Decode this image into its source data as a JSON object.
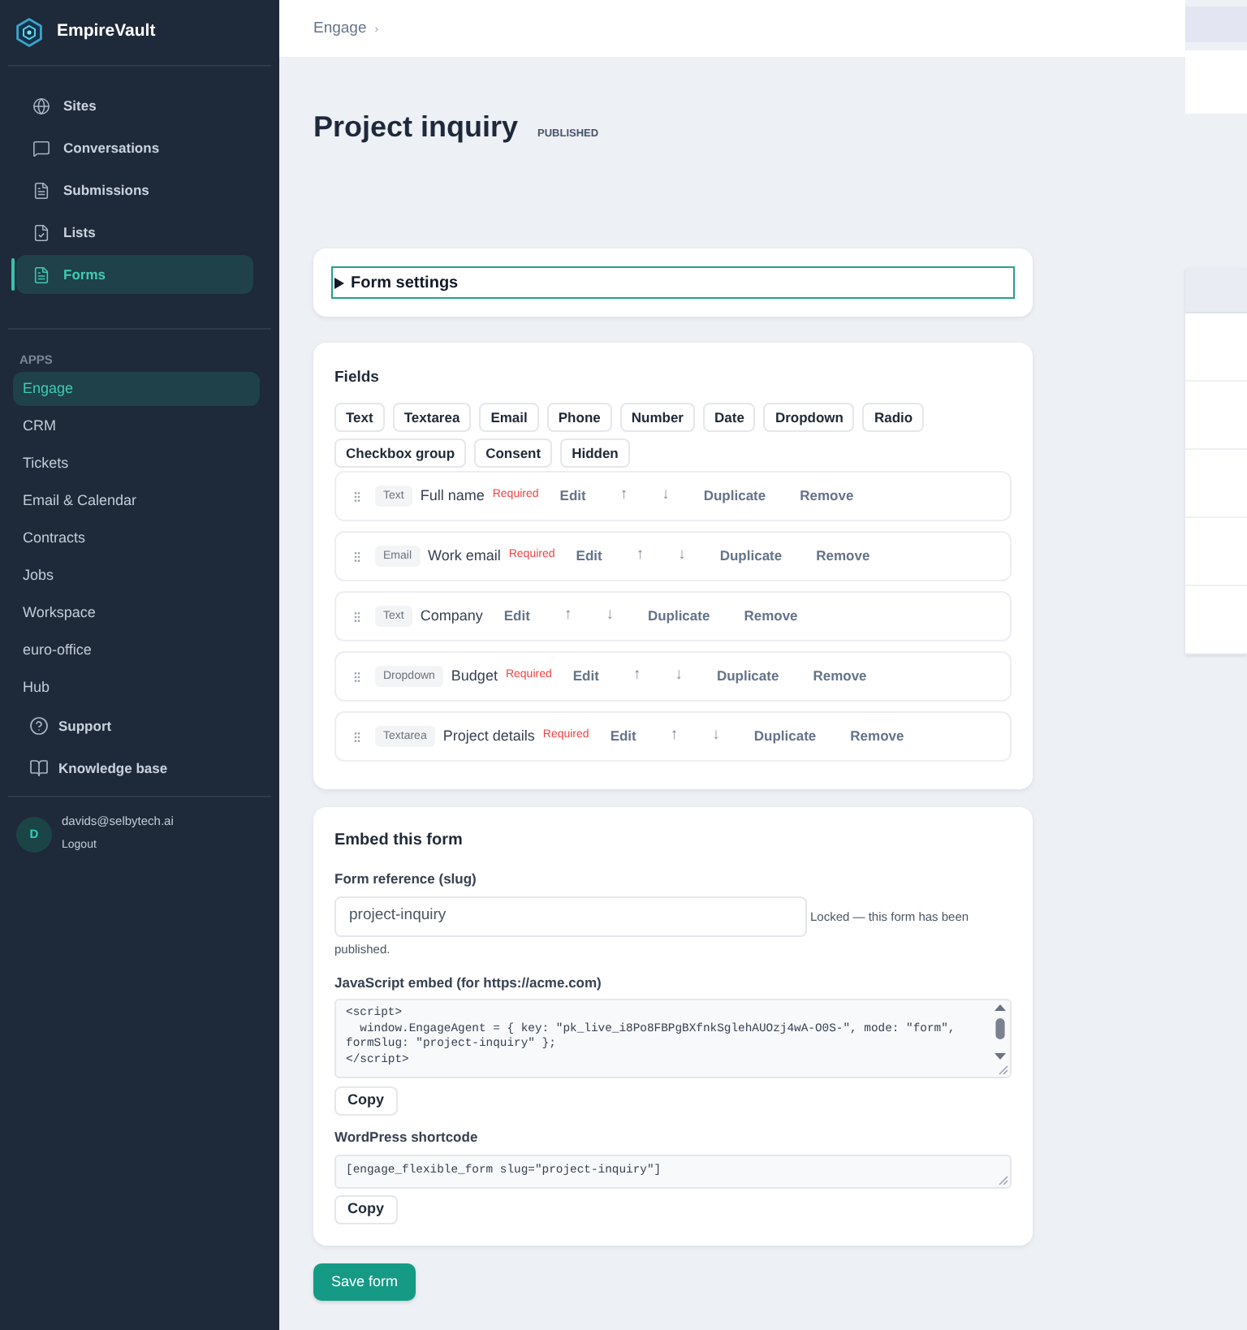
{
  "sidebar": {
    "brand": "EmpireVault",
    "nav": [
      {
        "label": "Sites",
        "selected": false
      },
      {
        "label": "Conversations",
        "selected": false
      },
      {
        "label": "Submissions",
        "selected": false
      },
      {
        "label": "Lists",
        "selected": false
      },
      {
        "label": "Forms",
        "selected": true
      }
    ],
    "apps_heading": "APPS",
    "apps": [
      {
        "label": "Engage",
        "selected": true
      },
      {
        "label": "CRM",
        "selected": false
      },
      {
        "label": "Tickets",
        "selected": false
      },
      {
        "label": "Email & Calendar",
        "selected": false
      },
      {
        "label": "Contracts",
        "selected": false
      },
      {
        "label": "Jobs",
        "selected": false
      },
      {
        "label": "Workspace",
        "selected": false
      },
      {
        "label": "euro-office",
        "selected": false
      },
      {
        "label": "Hub",
        "selected": false
      }
    ],
    "help": [
      {
        "label": "Support"
      },
      {
        "label": "Knowledge base"
      }
    ],
    "user": {
      "initial": "D",
      "email": "davids@selbytech.ai",
      "action": "Logout"
    }
  },
  "breadcrumb": [
    {
      "label": "Engage",
      "separator": "›"
    }
  ],
  "page": {
    "title": "Project inquiry",
    "status": "PUBLISHED"
  },
  "form_settings": {
    "label": "Form settings",
    "expanded": false
  },
  "fields": {
    "title": "Fields",
    "field_types": [
      "Text",
      "Textarea",
      "Email",
      "Phone",
      "Number",
      "Date",
      "Dropdown",
      "Radio",
      "Checkbox group",
      "Consent",
      "Hidden"
    ],
    "rows": [
      {
        "type": "Text",
        "label": "Full name",
        "required_note": "Required",
        "actions": [
          "Edit",
          "↑",
          "↓",
          "Duplicate",
          "Remove"
        ]
      },
      {
        "type": "Email",
        "label": "Work email",
        "required_note": "Required",
        "actions": [
          "Edit",
          "↑",
          "↓",
          "Duplicate",
          "Remove"
        ]
      },
      {
        "type": "Text",
        "label": "Company",
        "actions": [
          "Edit",
          "↑",
          "↓",
          "Duplicate",
          "Remove"
        ]
      },
      {
        "type": "Dropdown",
        "label": "Budget",
        "required_note": "Required",
        "actions": [
          "Edit",
          "↑",
          "↓",
          "Duplicate",
          "Remove"
        ]
      },
      {
        "type": "Textarea",
        "label": "Project details",
        "required_note": "Required",
        "actions": [
          "Edit",
          "↑",
          "↓",
          "Duplicate",
          "Remove"
        ]
      }
    ]
  },
  "embed": {
    "title": "Embed this form",
    "slug_label": "Form reference (slug)",
    "slug_value": "project-inquiry",
    "slug_note_lines": [
      "Locked — this form has been",
      "published."
    ],
    "js_label": "JavaScript embed (for https://acme.com)",
    "js_code_lines": [
      "<script>",
      "  window.EngageAgent = { key: \"pk_live_i8Po8FBPgBXfnkSglehAUOzj4wA-O0S-\", mode: \"form\",",
      "formSlug: \"project-inquiry\" };",
      "</script>"
    ],
    "js_copy": "Copy",
    "wp_label": "WordPress shortcode",
    "wp_code": "[engage_flexible_form slug=\"project-inquiry\"]",
    "wp_copy": "Copy"
  },
  "save_button": "Save form"
}
